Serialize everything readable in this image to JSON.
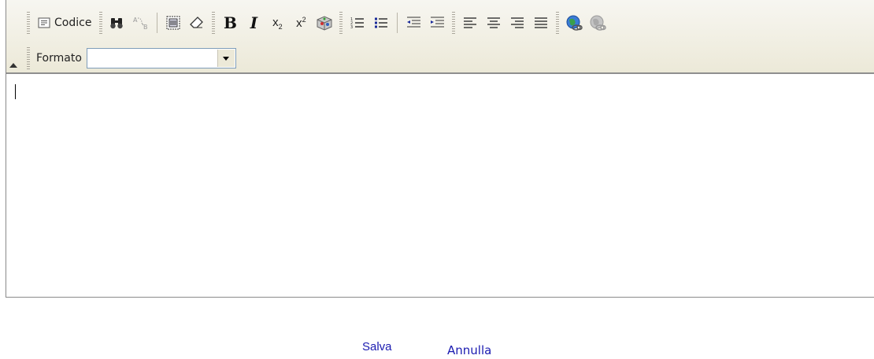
{
  "toolbar": {
    "code_label": "Codice",
    "format_label": "Formato",
    "format_value": "",
    "icons": [
      "source-code-icon",
      "find-icon",
      "replace-icon",
      "select-all-icon",
      "eraser-icon",
      "bold-icon",
      "italic-icon",
      "subscript-icon",
      "superscript-icon",
      "special-char-icon",
      "ordered-list-icon",
      "unordered-list-icon",
      "outdent-icon",
      "indent-icon",
      "align-left-icon",
      "align-center-icon",
      "align-right-icon",
      "justify-icon",
      "link-icon",
      "unlink-icon"
    ]
  },
  "editor": {
    "content": ""
  },
  "actions": {
    "save_label": "Salva",
    "cancel_label": "Annulla"
  },
  "colors": {
    "toolbar_bg": "#ece9d8",
    "link": "#1a1ab0"
  }
}
